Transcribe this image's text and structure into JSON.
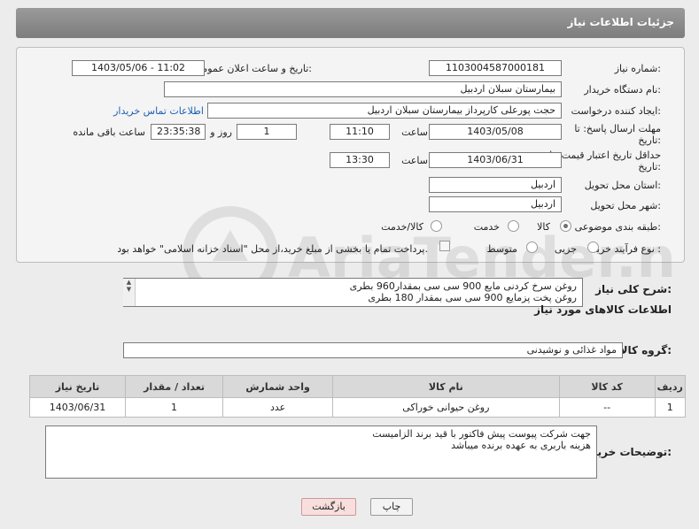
{
  "header": {
    "title": "جزئیات اطلاعات نیاز"
  },
  "form": {
    "need_number_label": "شماره نیاز:",
    "need_number": "1103004587000181",
    "announce_label": "تاریخ و ساعت اعلان عمومی:",
    "announce_value": "1403/05/06 - 11:02",
    "buyer_org_label": "نام دستگاه خریدار:",
    "buyer_org": "بیمارستان سبلان اردبیل",
    "creator_label": "ایجاد کننده درخواست:",
    "creator": "حجت پورعلی کارپرداز بیمارستان سبلان اردبیل",
    "contact_link": "اطلاعات تماس خریدار",
    "deadline_label": "مهلت ارسال پاسخ: تا",
    "deadline_label2": "تاریخ:",
    "deadline_date": "1403/05/08",
    "time_label": "ساعت",
    "deadline_time": "11:10",
    "days": "1",
    "days_label": "روز و",
    "remaining": "23:35:38",
    "remaining_label": "ساعت باقی مانده",
    "validity_label": "حداقل تاریخ اعتبار قیمت: تا",
    "validity_label2": "تاریخ:",
    "validity_date": "1403/06/31",
    "validity_time": "13:30",
    "province_label": "استان محل تحویل:",
    "province": "اردبیل",
    "city_label": "شهر محل تحویل:",
    "city": "اردبیل",
    "category_label": "طبقه بندی موضوعی:",
    "category_options": [
      "کالا",
      "خدمت",
      "کالا/خدمت"
    ],
    "process_label": "نوع فرآیند خرید :",
    "process_options": [
      "جزیی",
      "متوسط"
    ],
    "payment_note": "پرداخت تمام یا بخشی از مبلغ خرید،از محل \"اسناد خزانه اسلامی\" خواهد بود."
  },
  "description": {
    "label": "شرح کلی نیاز:",
    "lines": [
      "روغن سرخ کردنی مایع 900 سی سی بمقدار960 بطری",
      "روغن پخت پزمایع  900 سی سی  بمقدار 180 بطری"
    ]
  },
  "goods": {
    "section_title": "اطلاعات کالاهای مورد نیاز",
    "group_label": "گروه کالا:",
    "group_value": "مواد غذائی و نوشیدنی",
    "columns": [
      "ردیف",
      "کد کالا",
      "نام کالا",
      "واحد شمارش",
      "تعداد / مقدار",
      "تاریخ نیاز"
    ],
    "rows": [
      {
        "row": "1",
        "code": "--",
        "name": "روغن حیوانی خوراکی",
        "unit": "عدد",
        "qty": "1",
        "date": "1403/06/31"
      }
    ]
  },
  "buyer_notes": {
    "label": "توضیحات خریدار:",
    "lines": [
      "جهت شرکت پیوست پیش فاکتور با قید برند الزامیست",
      "هزینه باربری به عهده برنده میباشد"
    ]
  },
  "buttons": {
    "print": "چاپ",
    "back": "بازگشت"
  },
  "watermark": {
    "text": "AriaTender.neT"
  }
}
